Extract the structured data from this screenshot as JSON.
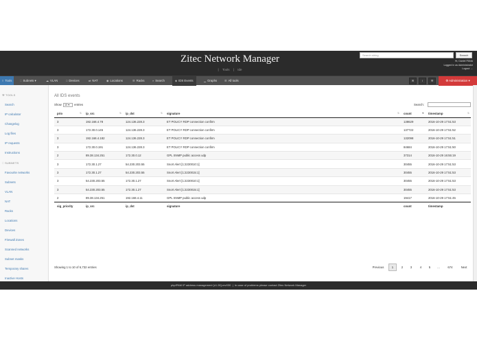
{
  "header": {
    "title": "Zitec Network Manager",
    "links": [
      "Tools",
      "Ide"
    ],
    "search_placeholder": "Search string",
    "search_button": "Search",
    "greeting": "Hi, Daniel PANA",
    "logged_as": "Logged in as Administrator",
    "logout": "Logout"
  },
  "nav": {
    "items": [
      {
        "label": "Tools",
        "icon": "home-icon"
      },
      {
        "label": "Subnets",
        "icon": "sitemap-icon"
      },
      {
        "label": "VLAN",
        "icon": "cloud-icon"
      },
      {
        "label": "Devices",
        "icon": "desktop-icon"
      },
      {
        "label": "NAT",
        "icon": "exchange-icon"
      },
      {
        "label": "Locations",
        "icon": "map-marker-icon"
      },
      {
        "label": "Racks",
        "icon": "bars-icon"
      },
      {
        "label": "Search",
        "icon": "search-icon"
      },
      {
        "label": "IDS Events",
        "icon": "shield-icon"
      },
      {
        "label": "Graphs",
        "icon": "chart-icon"
      },
      {
        "label": "All tools",
        "icon": "list-icon"
      }
    ],
    "admin_label": "Administration"
  },
  "sidebar": {
    "tools_header": "TOOLS",
    "tools": [
      "Search",
      "IP calculator",
      "Changelog",
      "Log files",
      "IP requests",
      "Instructions"
    ],
    "subnets_header": "SUBNETS",
    "subnets": [
      "Favourite networks",
      "Subnets",
      "VLAN",
      "NAT",
      "Racks",
      "Locations",
      "Devices",
      "Firewall Zones",
      "Scanned networks",
      "Subnet masks",
      "Temporary shares",
      "Inactive Hosts"
    ]
  },
  "main": {
    "title": "All IDS events",
    "show_label": "Show",
    "show_value": "10",
    "entries_label": "entries",
    "search_label": "Search:",
    "columns": [
      "prio",
      "ip_src",
      "ip_dst",
      "signature",
      "count",
      "timestamp"
    ],
    "footer_columns": [
      "sig_priority",
      "ip_src",
      "ip_dst",
      "signature",
      "count",
      "timestamp"
    ],
    "rows": [
      [
        "3",
        "192.168.4.78",
        "124.136.228.3",
        "ET POLICY RDP connection confirm",
        "138629",
        "2016-10-29 17:51:53"
      ],
      [
        "3",
        "172.30.0.145",
        "124.136.228.3",
        "ET POLICY RDP connection confirm",
        "137722",
        "2016-10-29 17:51:52"
      ],
      [
        "3",
        "192.168.4.182",
        "124.136.228.3",
        "ET POLICY RDP connection confirm",
        "132098",
        "2016-10-29 17:51:51"
      ],
      [
        "3",
        "172.30.0.191",
        "124.136.228.3",
        "ET POLICY RDP connection confirm",
        "84684",
        "2016-10-29 17:51:50"
      ],
      [
        "2",
        "89.38.134.251",
        "172.30.0.12",
        "GPL SNMP public access udp",
        "37314",
        "2016-10-29 16:55:19"
      ],
      [
        "3",
        "172.30.1.27",
        "54.230.203.55",
        "Snort Alert [1:2230010:1]",
        "30455",
        "2016-10-29 17:51:53"
      ],
      [
        "3",
        "172.30.1.27",
        "54.230.203.55",
        "Snort Alert [1:2230015:1]",
        "30455",
        "2016-10-29 17:51:53"
      ],
      [
        "3",
        "54.230.203.55",
        "172.30.1.27",
        "Snort Alert [1:2230010:1]",
        "30455",
        "2016-10-29 17:51:53"
      ],
      [
        "3",
        "54.230.203.55",
        "172.30.1.27",
        "Snort Alert [1:2230015:1]",
        "30455",
        "2016-10-29 17:51:53"
      ],
      [
        "2",
        "89.38.134.251",
        "192.168.4.11",
        "GPL SNMP public access udp",
        "19417",
        "2016-10-29 17:51:45"
      ]
    ],
    "info": "Showing 1 to 10 of 6,732 entries",
    "pagination": {
      "previous": "Previous",
      "pages": [
        "1",
        "2",
        "3",
        "4",
        "5",
        "...",
        "674"
      ],
      "next": "Next"
    }
  },
  "footer": {
    "left": "phpIPAM IP address management [v1.26]-rev030",
    "right": "In case of problems please contact Zitec Network Manager"
  }
}
